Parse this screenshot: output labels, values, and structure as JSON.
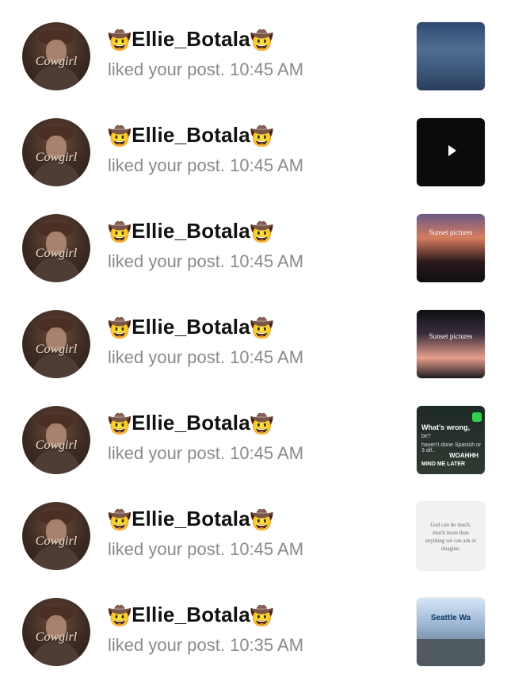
{
  "notifications": [
    {
      "user": "Ellie_Botala",
      "emoji_left": "🤠",
      "emoji_right": "🤠",
      "message": "liked your post.",
      "time": "10:45 AM",
      "avatar_logo": "Cowgirl",
      "thumbnail_caption": ""
    },
    {
      "user": "Ellie_Botala",
      "emoji_left": "🤠",
      "emoji_right": "🤠",
      "message": "liked your post.",
      "time": "10:45 AM",
      "avatar_logo": "Cowgirl",
      "thumbnail_caption": ""
    },
    {
      "user": "Ellie_Botala",
      "emoji_left": "🤠",
      "emoji_right": "🤠",
      "message": "liked your post.",
      "time": "10:45 AM",
      "avatar_logo": "Cowgirl",
      "thumbnail_caption": "Sunset pictures"
    },
    {
      "user": "Ellie_Botala",
      "emoji_left": "🤠",
      "emoji_right": "🤠",
      "message": "liked your post.",
      "time": "10:45 AM",
      "avatar_logo": "Cowgirl",
      "thumbnail_caption": "Sunset pictures"
    },
    {
      "user": "Ellie_Botala",
      "emoji_left": "🤠",
      "emoji_right": "🤠",
      "message": "liked your post.",
      "time": "10:45 AM",
      "avatar_logo": "Cowgirl",
      "thumbnail_text": {
        "title": "What's wrong,",
        "line2": "be?",
        "line3": "haven't done Spanish or 3 dif..",
        "shout": "WOAHHH",
        "footer": "MIND ME LATER"
      }
    },
    {
      "user": "Ellie_Botala",
      "emoji_left": "🤠",
      "emoji_right": "🤠",
      "message": "liked your post.",
      "time": "10:45 AM",
      "avatar_logo": "Cowgirl",
      "thumbnail_quote": "God can do much, much more than anything we can ask or imagine."
    },
    {
      "user": "Ellie_Botala",
      "emoji_left": "🤠",
      "emoji_right": "🤠",
      "message": "liked your post.",
      "time": "10:35 AM",
      "avatar_logo": "Cowgirl",
      "thumbnail_caption": "Seattle Wa"
    }
  ]
}
